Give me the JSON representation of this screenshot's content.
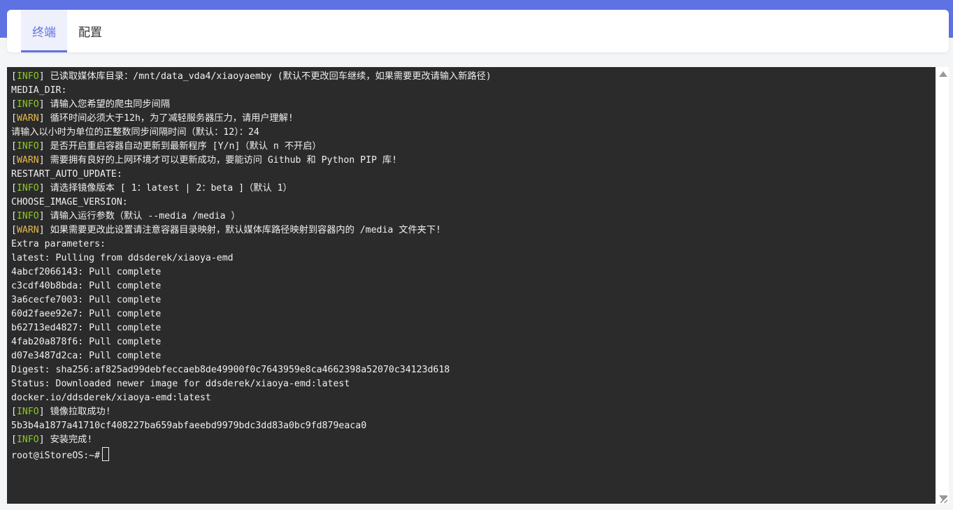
{
  "tabs": [
    {
      "label": "终端",
      "active": true
    },
    {
      "label": "配置",
      "active": false
    }
  ],
  "colors": {
    "accent": "#5e72e4",
    "terminal_bg": "#2b2b2b",
    "info_tag": "#8ac926",
    "warn_tag": "#e5b94b"
  },
  "terminal": {
    "lines": [
      {
        "tag": "INFO",
        "text": " 已读取媒体库目录：/mnt/data_vda4/xiaoyaemby (默认不更改回车继续，如果需要更改请输入新路径)"
      },
      {
        "tag": "",
        "text": "MEDIA_DIR:"
      },
      {
        "tag": "INFO",
        "text": " 请输入您希望的爬虫同步间隔"
      },
      {
        "tag": "WARN",
        "text": " 循环时间必须大于12h，为了减轻服务器压力，请用户理解!"
      },
      {
        "tag": "",
        "text": "请输入以小时为单位的正整数同步间隔时间（默认：12）：24"
      },
      {
        "tag": "INFO",
        "text": " 是否开启重启容器自动更新到最新程序 [Y/n]（默认 n 不开启）"
      },
      {
        "tag": "WARN",
        "text": " 需要拥有良好的上网环境才可以更新成功，要能访问 Github 和 Python PIP 库!"
      },
      {
        "tag": "",
        "text": "RESTART_AUTO_UPDATE:"
      },
      {
        "tag": "INFO",
        "text": " 请选择镜像版本 [ 1：latest | 2：beta ]（默认 1）"
      },
      {
        "tag": "",
        "text": "CHOOSE_IMAGE_VERSION:"
      },
      {
        "tag": "INFO",
        "text": " 请输入运行参数（默认 --media /media ）"
      },
      {
        "tag": "WARN",
        "text": " 如果需要更改此设置请注意容器目录映射，默认媒体库路径映射到容器内的 /media 文件夹下!"
      },
      {
        "tag": "",
        "text": "Extra parameters:"
      },
      {
        "tag": "",
        "text": "latest: Pulling from ddsderek/xiaoya-emd"
      },
      {
        "tag": "",
        "text": "4abcf2066143: Pull complete"
      },
      {
        "tag": "",
        "text": "c3cdf40b8bda: Pull complete"
      },
      {
        "tag": "",
        "text": "3a6cecfe7003: Pull complete"
      },
      {
        "tag": "",
        "text": "60d2faee92e7: Pull complete"
      },
      {
        "tag": "",
        "text": "b62713ed4827: Pull complete"
      },
      {
        "tag": "",
        "text": "4fab20a878f6: Pull complete"
      },
      {
        "tag": "",
        "text": "d07e3487d2ca: Pull complete"
      },
      {
        "tag": "",
        "text": "Digest: sha256:af825ad99debfeccaeb8de49900f0c7643959e8ca4662398a52070c34123d618"
      },
      {
        "tag": "",
        "text": "Status: Downloaded newer image for ddsderek/xiaoya-emd:latest"
      },
      {
        "tag": "",
        "text": "docker.io/ddsderek/xiaoya-emd:latest"
      },
      {
        "tag": "INFO",
        "text": " 镜像拉取成功!"
      },
      {
        "tag": "",
        "text": "5b3b4a1877a41710cf408227ba659abfaeebd9979bdc3dd83a0bc9fd879eaca0"
      },
      {
        "tag": "INFO",
        "text": " 安装完成!"
      }
    ],
    "prompt": "root@iStoreOS:~#"
  }
}
